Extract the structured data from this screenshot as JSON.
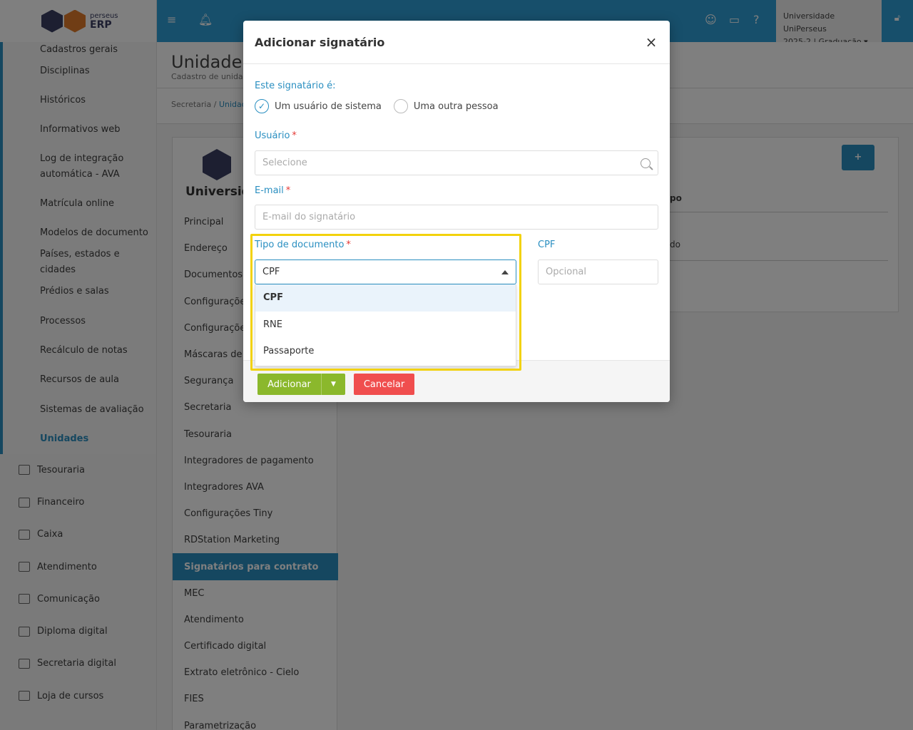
{
  "logo": {
    "brand_top": "perseus",
    "brand_bottom": "ERP"
  },
  "sidebar": {
    "sub_items": [
      "Cadastros gerais",
      "Disciplinas",
      "Históricos",
      "Informativos web",
      "Log de integração automática - AVA",
      "Matrícula online",
      "Modelos de documento",
      "Países, estados e cidades",
      "Prédios e salas",
      "Processos",
      "Recálculo de notas",
      "Recursos de aula",
      "Sistemas de avaliação",
      "Unidades"
    ],
    "main_items": [
      "Tesouraria",
      "Financeiro",
      "Caixa",
      "Atendimento",
      "Comunicação",
      "Diploma digital",
      "Secretaria digital",
      "Loja de cursos"
    ]
  },
  "topbar": {
    "org_name": "Universidade UniPerseus",
    "period": "2025-2 | Graduação"
  },
  "page": {
    "title": "Unidade",
    "subtitle": "Cadastro de unidade",
    "breadcrumb_1": "Secretaria",
    "breadcrumb_sep": "/",
    "breadcrumb_2": "Unidad",
    "unit_name": "Universida",
    "unit_menu": [
      "Principal",
      "Endereço",
      "Documentos",
      "Configurações",
      "Configurações",
      "Máscaras de re",
      "Segurança",
      "Secretaria",
      "Tesouraria",
      "Integradores de pagamento",
      "Integradores AVA",
      "Configurações Tiny",
      "RDStation Marketing",
      "Signatários para contrato",
      "MEC",
      "Atendimento",
      "Certificado digital",
      "Extrato eletrônico - Cielo",
      "FIES",
      "Parametrização"
    ],
    "table_head": "po",
    "table_cell": "do"
  },
  "modal": {
    "title": "Adicionar signatário",
    "close": "×",
    "type_label": "Este signatário é:",
    "radio_system": "Um usuário de sistema",
    "radio_other": "Uma outra pessoa",
    "user_label": "Usuário",
    "user_placeholder": "Selecione",
    "email_label": "E-mail",
    "email_placeholder": "E-mail do signatário",
    "doc_type_label": "Tipo de documento",
    "doc_type_value": "CPF",
    "doc_type_options": [
      "CPF",
      "RNE",
      "Passaporte"
    ],
    "doc_label": "CPF",
    "doc_placeholder": "Opcional",
    "required_mark": "*",
    "add_button": "Adicionar",
    "cancel_button": "Cancelar"
  },
  "colors": {
    "accent": "#2a8fc1",
    "highlight": "#f2d20c",
    "add": "#8bb82c",
    "cancel": "#f04e4e"
  }
}
